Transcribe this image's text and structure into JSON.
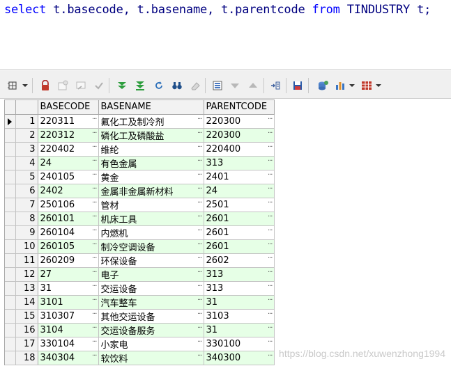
{
  "editor": {
    "sql_select": "select",
    "sql_columns": " t.basecode, t.basename, t.parentcode ",
    "sql_from": "from",
    "sql_table": " TINDUSTRY t;"
  },
  "toolbar": {
    "icons": [
      "grid-options-icon",
      "lock-icon",
      "new-row-icon",
      "delete-row-icon",
      "post-changes-icon",
      "fetch-next-icon",
      "fetch-all-icon",
      "refresh-icon",
      "find-icon",
      "clear-icon",
      "single-record-view-icon",
      "sort-down-icon",
      "sort-up-icon",
      "export-icon",
      "save-icon",
      "connect-icon",
      "chart-icon",
      "table-view-icon"
    ]
  },
  "grid": {
    "columns": [
      "BASECODE",
      "BASENAME",
      "PARENTCODE"
    ],
    "current_row": 1,
    "rows": [
      [
        "1",
        "220311",
        "氟化工及制冷剂",
        "220300"
      ],
      [
        "2",
        "220312",
        "磷化工及磷酸盐",
        "220300"
      ],
      [
        "3",
        "220402",
        "维纶",
        "220400"
      ],
      [
        "4",
        "24",
        "有色金属",
        "313"
      ],
      [
        "5",
        "240105",
        "黄金",
        "2401"
      ],
      [
        "6",
        "2402",
        "金属非金属新材料",
        "24"
      ],
      [
        "7",
        "250106",
        "管材",
        "2501"
      ],
      [
        "8",
        "260101",
        "机床工具",
        "2601"
      ],
      [
        "9",
        "260104",
        "内燃机",
        "2601"
      ],
      [
        "10",
        "260105",
        "制冷空调设备",
        "2601"
      ],
      [
        "11",
        "260209",
        "环保设备",
        "2602"
      ],
      [
        "12",
        "27",
        "电子",
        "313"
      ],
      [
        "13",
        "31",
        "交运设备",
        "313"
      ],
      [
        "14",
        "3101",
        "汽车整车",
        "31"
      ],
      [
        "15",
        "310307",
        "其他交运设备",
        "3103"
      ],
      [
        "16",
        "3104",
        "交运设备服务",
        "31"
      ],
      [
        "17",
        "330104",
        "小家电",
        "330100"
      ],
      [
        "18",
        "340304",
        "软饮料",
        "340300"
      ]
    ]
  },
  "watermark": "https://blog.csdn.net/xuwenzhong1994",
  "colors": {
    "alt_row": "#e6ffe6",
    "keyword": "#0000ff",
    "identifier": "#000080"
  }
}
